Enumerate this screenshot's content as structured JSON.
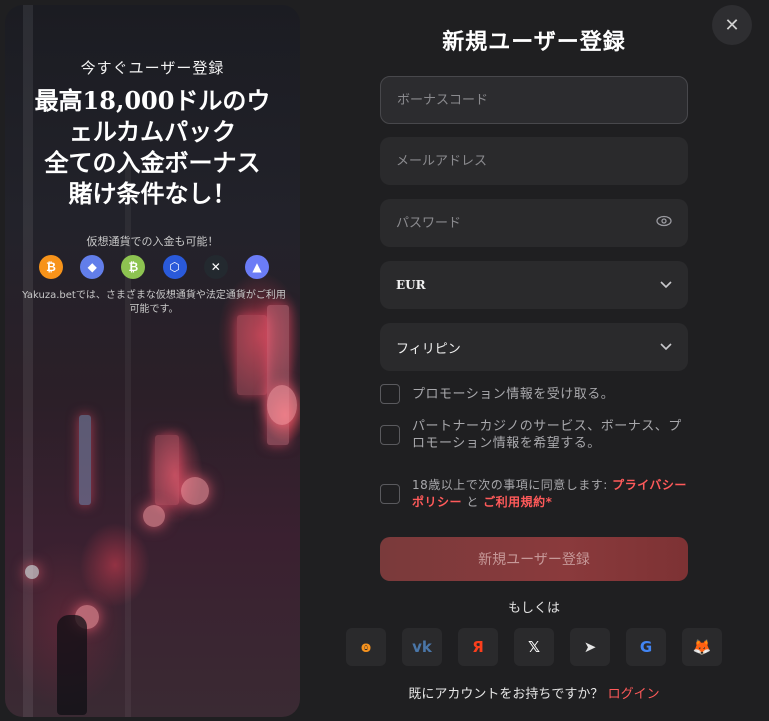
{
  "promo": {
    "subtitle": "今すぐユーザー登録",
    "headline_line1": "最高18,000ドルのウ",
    "headline_line2": "ェルカムパック",
    "headline_line3": "全ての入金ボーナス",
    "headline_line4": "賭け条件なし！",
    "crypto_note": "仮想通貨での入金も可能！",
    "coins": [
      {
        "icon": "bitcoin-icon",
        "glyph": "₿",
        "color": "#f7931a"
      },
      {
        "icon": "ethereum-icon",
        "glyph": "◆",
        "color": "#627eea"
      },
      {
        "icon": "bitcoin-cash-icon",
        "glyph": "₿",
        "color": "#8dc351"
      },
      {
        "icon": "chainlink-icon",
        "glyph": "⬡",
        "color": "#2a5ada"
      },
      {
        "icon": "xrp-icon",
        "glyph": "✕",
        "color": "#23292f"
      },
      {
        "icon": "tron-icon",
        "glyph": "▲",
        "color": "#6b7cf6"
      }
    ],
    "fiat_note": "Yakuza.betでは、さまざまな仮想通貨や法定通貨がご利用可能です。"
  },
  "form": {
    "title": "新規ユーザー登録",
    "bonus_placeholder": "ボーナスコード",
    "email_placeholder": "メールアドレス",
    "password_placeholder": "パスワード",
    "currency_value": "EUR",
    "country_value": "フィリピン",
    "promo_opt_label": "プロモーション情報を受け取る。",
    "partner_opt_label": "パートナーカジノのサービス、ボーナス、プロモーション情報を希望する。",
    "terms_prefix": "18歳以上で次の事項に同意します: ",
    "privacy_link": "プライバシーポリシー",
    "terms_and": " と ",
    "terms_link": "ご利用規約",
    "terms_required": "*",
    "submit_label": "新規ユーザー登録",
    "or_label": "もしくは",
    "login_prompt": "既にアカウントをお持ちですか？ ",
    "login_link": "ログイン"
  },
  "socials": [
    {
      "icon": "odnoklassniki-icon",
      "glyph": "ꙩ",
      "color": "#f7931e"
    },
    {
      "icon": "vk-icon",
      "glyph": "vk",
      "color": "#4a76a8"
    },
    {
      "icon": "yandex-icon",
      "glyph": "Я",
      "color": "#fc3f1d"
    },
    {
      "icon": "x-icon",
      "glyph": "𝕏",
      "color": "#ffffff"
    },
    {
      "icon": "telegram-icon",
      "glyph": "➤",
      "color": "#e6e6e6"
    },
    {
      "icon": "google-icon",
      "glyph": "G",
      "color": "#4285f4"
    },
    {
      "icon": "metamask-icon",
      "glyph": "🦊",
      "color": "#f6851b"
    }
  ],
  "colors": {
    "accent": "#ff5a5a",
    "background": "#1f1f21",
    "field": "#2a2a2c"
  },
  "close_icon": "close-icon"
}
